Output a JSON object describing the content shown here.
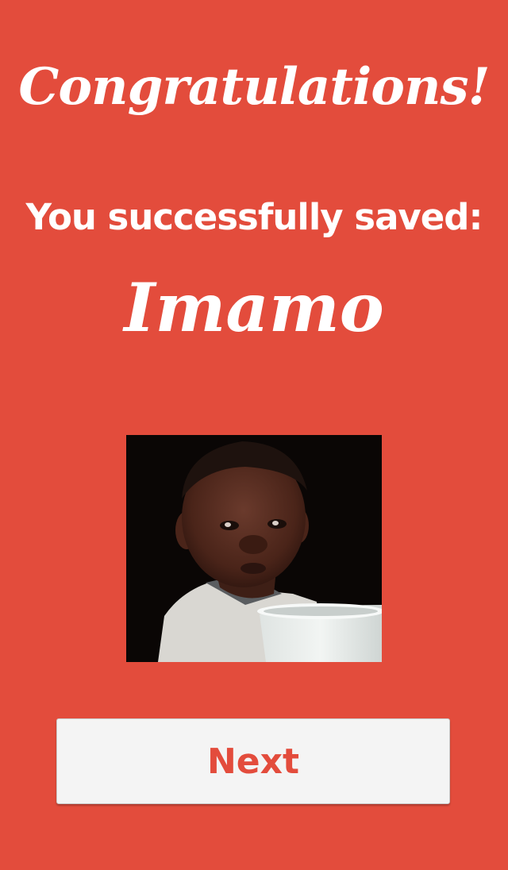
{
  "screen": {
    "title": "Congratulations!",
    "subtitle": "You successfully saved:",
    "saved_name": "Imamo",
    "photo_icon": "child-photo",
    "next_label": "Next"
  },
  "colors": {
    "background": "#e34c3c",
    "button_bg": "#f4f4f4",
    "button_text": "#e34c3c",
    "text": "#ffffff"
  }
}
